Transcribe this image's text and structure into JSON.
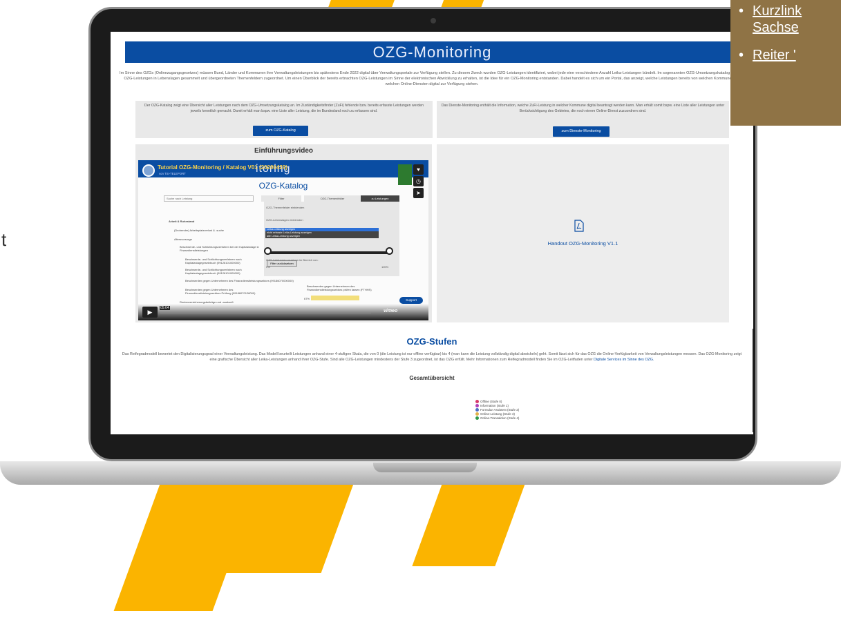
{
  "stage_text": "t",
  "site": {
    "header_title": "OZG-Monitoring",
    "intro": "Im Sinne des OZGs (Onlinezugangsgesetzes) müssen Bund, Länder und Kommunen ihre Verwaltungsleistungen bis spätestens Ende 2022 digital über Verwaltungsportale zur Verfügung stellen. Zu diesem Zweck wurden OZG-Leistungen identifiziert, wobei jede eine verschiedene Anzahl Leika-Leistungen bündelt. Im sogenannten OZG-Umsetzungskatalog sind die OZG-Leistungen in Lebenslagen gesammelt und übergeordneten Themenfeldern zugeordnet. Um einen Überblick der bereits erbrachten OZG-Leistungen im Sinne der elektronischen Abwicklung zu erhalten, ist die Idee für ein OZG-Monitoring entstanden. Dabei handelt es sich um ein Portal, das anzeigt, welche Leistungen bereits von welchen Kommunen mit welchen Online-Diensten digital zur Verfügung stehen.",
    "card1_text": "Der OZG-Katalog zeigt eine Übersicht aller Leistungen nach dem OZG-Umsetzungskatalog an. Im Zuständigkeitsfinder (ZuFi) fehlende bzw. bereits erfasste Leistungen werden jeweils kenntlich gemacht. Damit erhält man bspw. eine Liste aller Leistung, die im Bundesland noch zu erfassen sind.",
    "card1_button": "zum OZG-Katalog",
    "card2_text": "Das Dienste-Monitoring enthält die Information, welche ZuFi-Leistung in welcher Kommune digital beantragt werden kann. Man erhält somit bspw. eine Liste aller Leistungen unter Berücksichtigung des Gebietes, die noch einem Online-Dienst zuzuordnen sind.",
    "card2_button": "zum Dienste-Monitoring",
    "video_section_title": "Einführungsvideo",
    "handout_link": "Handout OZG-Monitoring V1.1",
    "stufen_title": "OZG-Stufen",
    "stufen_text": "Das Reifegradmodell bewertet den Digitalisierungsgrad einer Verwaltungsleistung. Das Modell beurteilt Leistungen anhand einer 4-stufigen Skala, die von 0 (die Leistung ist nur offline verfügbar) bis 4 (man kann die Leistung vollständig digital abwickeln) geht. Somit lässt sich für das OZG die Online-Verfügbarkeit von Verwaltungsleistungen messen. Das OZG-Monitoring zeigt eine grafische Übersicht aller Leika-Leistungen anhand ihrer OZG-Stufe. Sind alle OZG-Leistungen mindestens der Stufe 3 zugeordnet, ist das OZG erfüllt. Mehr Informationen zum Reifegradmodell finden Sie im OZG-Leitfaden unter",
    "stufen_link": "Digitale Services im Sinne des OZG.",
    "gesamt_title": "Gesamtübersicht",
    "legend": [
      {
        "label": "Offline (Stufe 0)",
        "color": "#d63a6a"
      },
      {
        "label": "Information (Stufe 1)",
        "color": "#b03fb8"
      },
      {
        "label": "Formular-Assistent (Stufe 2)",
        "color": "#4e6fc4"
      },
      {
        "label": "Online-Leistung (Stufe 3)",
        "color": "#e0b24a"
      },
      {
        "label": "Online-Transaktion (Stufe 4)",
        "color": "#2f9a4a"
      }
    ]
  },
  "video": {
    "title": "Tutorial OZG-Monitoring / Katalog V01 (20200429)",
    "byline": "von TSI-TELEPORT",
    "bg_title": "itoring",
    "katalog_title": "OZG-Katalog",
    "search_placeholder": "Suche nach Leistung",
    "filter_label": "Filter",
    "themen_label": "OZG-Themenfelder",
    "leistungen_label": "zu Leistungen",
    "panel_line1": "OZG-Themenfelder einblenden",
    "panel_line2": "OZG-Lebenslagen einblenden",
    "dd_options": [
      "Leika-Leistung anzeigen",
      "nicht erfasste Leika-Leistung anzeigen",
      "alle Leika-Leistung anzeigen"
    ],
    "panel_line3": "OZG-Leistungen anzeigen im Bereich von:",
    "slider_min": "0%",
    "slider_max": "100%",
    "reset_label": "Filter zurücksetzen",
    "tree": [
      "Arbeit & Ruhestand",
      "(Drohender) Arbeitsplatzverlust & -suche",
      "Altersvorsorge",
      "Beschwerde- und Schlichtungsverfahren bei der Kapitalanlage in Finanzdienstleistungen",
      "Beschwerde- und Schlichtungsverfahren nach Kapitalanlagegesetzbuch (99126101000000)",
      "Beschwerde- und Schlichtungsverfahren nach Kapitalanlagegesetzbuch (99126101000000)",
      "Beschwerden gegen Unternehmen des Finanzdienstleistungssektors (99186070000000)",
      "Beschwerden gegen Unternehmen des Finanzdienstleistungssektors Prüfung (99186070128000)",
      "Rentenversicherungsbeiträge und -auskunft"
    ],
    "right_note": "Beschwerden gegen Unternehmen des Finanzdienstleistungssektors prüfen lassen (FTHHS)",
    "percent": "67%",
    "time": "05:04",
    "support_label": "Support",
    "vimeo": "vimeo"
  },
  "note": {
    "items": [
      "Kurzlink",
      "Sachse",
      "Reiter '"
    ]
  }
}
